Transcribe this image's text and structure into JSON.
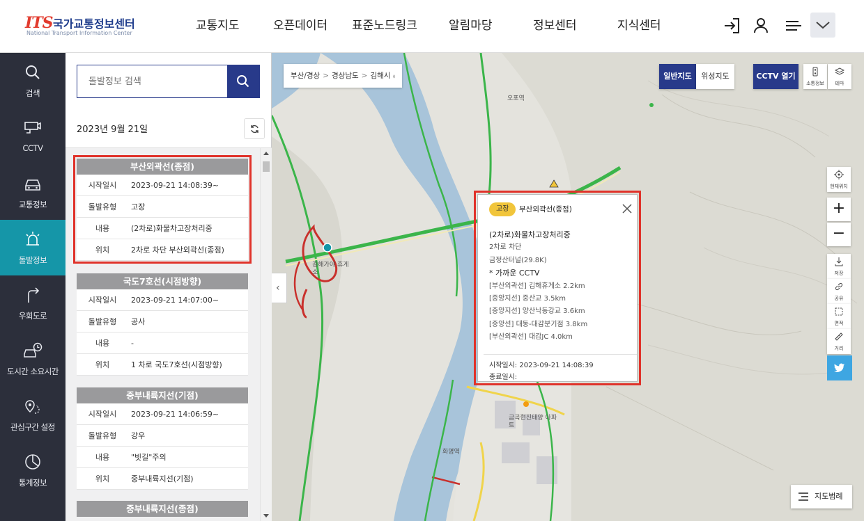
{
  "header": {
    "logo_mark": "ITS",
    "logo_ko": "국가교통정보센터",
    "logo_en": "National Transport Information Center",
    "nav": [
      "교통지도",
      "오픈데이터",
      "표준노드링크",
      "알림마당",
      "정보센터",
      "지식센터"
    ],
    "icons": [
      "login-icon",
      "user-icon",
      "menu-icon",
      "chevron-down-icon"
    ]
  },
  "sidebar": {
    "items": [
      {
        "label": "검색",
        "icon": "search-icon"
      },
      {
        "label": "CCTV",
        "icon": "cctv-icon"
      },
      {
        "label": "교통정보",
        "icon": "car-icon"
      },
      {
        "label": "돌발정보",
        "icon": "siren-icon",
        "active": true
      },
      {
        "label": "우회도로",
        "icon": "detour-icon"
      },
      {
        "label": "도시간 소요시간",
        "icon": "car-clock-icon"
      },
      {
        "label": "관심구간 설정",
        "icon": "pin-route-icon"
      },
      {
        "label": "통계정보",
        "icon": "chart-icon"
      }
    ]
  },
  "panel": {
    "search_placeholder": "돌발정보 검색",
    "date": "2023년 9월 21일",
    "cards": [
      {
        "title": "부산외곽선(종점)",
        "rows": [
          {
            "key": "시작일시",
            "value": "2023-09-21  14:08:39~"
          },
          {
            "key": "돌발유형",
            "value": "고장"
          },
          {
            "key": "내용",
            "value": "(2차로)화물차고장처리중"
          },
          {
            "key": "위치",
            "value": "2차로  차단  부산외곽선(종점)"
          }
        ]
      },
      {
        "title": "국도7호선(시점방향)",
        "rows": [
          {
            "key": "시작일시",
            "value": "2023-09-21  14:07:00~"
          },
          {
            "key": "돌발유형",
            "value": "공사"
          },
          {
            "key": "내용",
            "value": "-"
          },
          {
            "key": "위치",
            "value": "1  차로  국도7호선(시점방향)"
          }
        ]
      },
      {
        "title": "중부내륙지선(기점)",
        "rows": [
          {
            "key": "시작일시",
            "value": "2023-09-21  14:06:59~"
          },
          {
            "key": "돌발유형",
            "value": "강우"
          },
          {
            "key": "내용",
            "value": "\"빗길\"주의"
          },
          {
            "key": "위치",
            "value": "중부내륙지선(기점)"
          }
        ]
      },
      {
        "title": "중부내륙지선(종점)",
        "rows": []
      }
    ]
  },
  "map": {
    "breadcrumb": [
      "부산/경상",
      "경상남도",
      "김해시"
    ],
    "breadcrumb_caret": "⬨",
    "map_types": [
      "일반지도",
      "위성지도"
    ],
    "cctv_button": "CCTV 열기",
    "tools_top": [
      "소통정보",
      "테마"
    ],
    "current_location": "현재위치",
    "zoom_in": "+",
    "zoom_out": "−",
    "tools": [
      "저장",
      "공유",
      "면적",
      "거리"
    ],
    "legend": "지도범례",
    "labels": [
      "오포역",
      "김해가야 휴게소",
      "금곡현진태양 아파트",
      "화명역"
    ],
    "popup": {
      "badge": "고장",
      "title": "부산외곽선(종점)",
      "headline": "(2차로)화물차고장처리중",
      "lines": [
        "2차로  차단",
        "금정산터널(29.8K)"
      ],
      "cctv_heading": "* 가까운 CCTV",
      "cctv": [
        "[부산외곽선] 김해휴게소 2.2km",
        "[중앙지선] 중산교 3.5km",
        "[중앙지선] 양산낙동강교 3.6km",
        "[중앙선] 대동-대감분기점 3.8km",
        "[부산외곽선] 대감JC 4.0km"
      ],
      "start_label": "시작일시:",
      "start_value": "2023-09-21  14:08:39",
      "end_label": "종료일시:",
      "end_value": ""
    }
  },
  "colors": {
    "nav_bg": "#2c2f3b",
    "active": "#1596a8",
    "brand": "#283a8a",
    "highlight": "#e0322a",
    "badge": "#f1c53b",
    "river": "#a8c4da",
    "road_flow": "#3bb54a",
    "road_jam": "#d23a2c"
  }
}
